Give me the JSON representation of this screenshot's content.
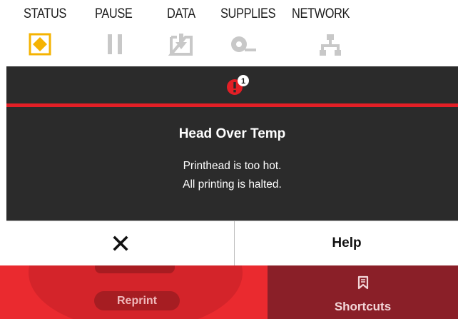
{
  "status_bar": {
    "items": [
      {
        "label": "STATUS",
        "icon": "status-diamond-icon",
        "color": "#f5b301"
      },
      {
        "label": "PAUSE",
        "icon": "pause-icon",
        "color": "#c8c8c8"
      },
      {
        "label": "DATA",
        "icon": "data-download-icon",
        "color": "#c8c8c8"
      },
      {
        "label": "SUPPLIES",
        "icon": "supplies-roll-icon",
        "color": "#c8c8c8"
      },
      {
        "label": "NETWORK",
        "icon": "network-icon",
        "color": "#c8c8c8"
      }
    ]
  },
  "alert": {
    "badge_count": "1",
    "icon": "error-alert-icon",
    "title": "Head Over Temp",
    "message_line1": "Printhead is too hot.",
    "message_line2": "All printing is halted.",
    "close_icon": "close-icon",
    "help_label": "Help",
    "accent_color": "#e21f26"
  },
  "bottom_bar": {
    "reprint_label": "Reprint",
    "shortcuts_label": "Shortcuts",
    "shortcuts_icon": "bookmark-icon"
  }
}
